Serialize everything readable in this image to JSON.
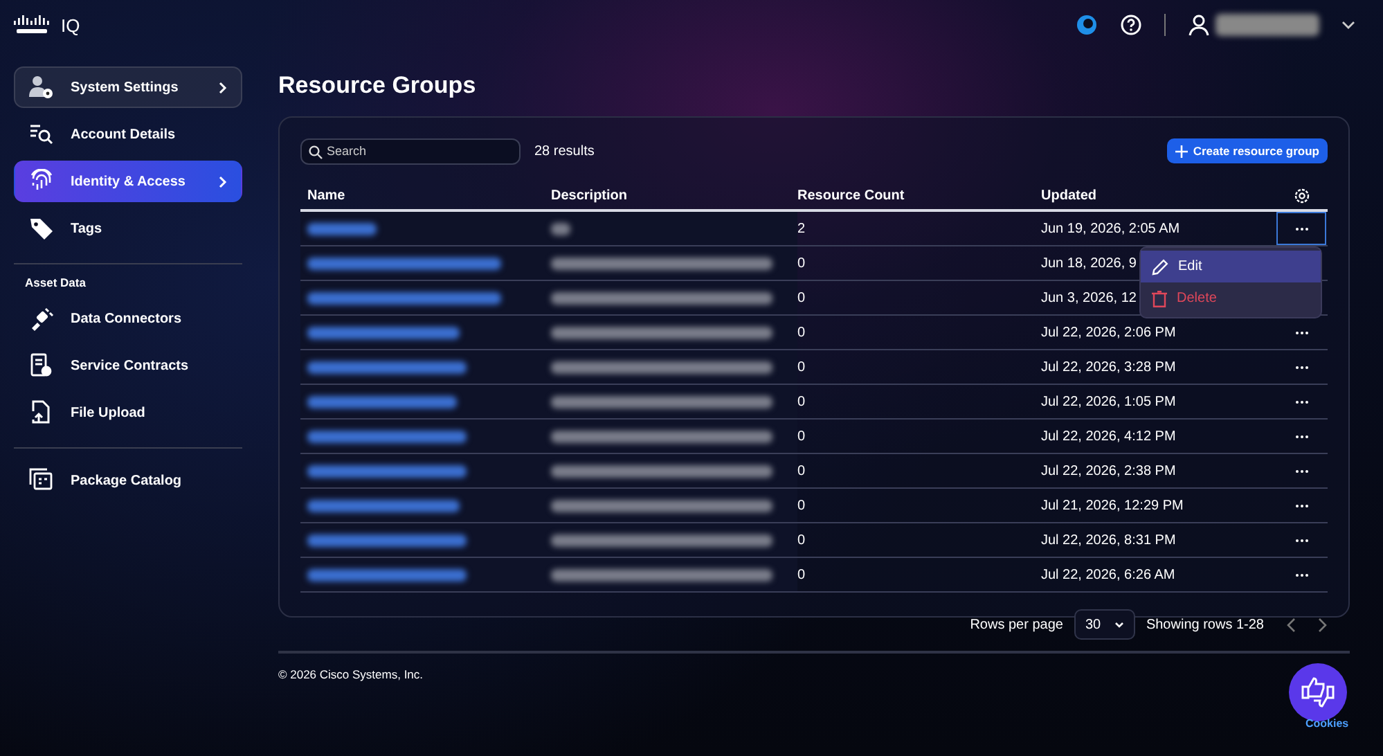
{
  "brand": {
    "product": "IQ"
  },
  "sidebar": {
    "items": [
      {
        "kind": "item",
        "label": "System Settings",
        "chevron": true,
        "selected": false,
        "boxed": true
      },
      {
        "kind": "item",
        "label": "Account Details",
        "chevron": false,
        "selected": false,
        "boxed": false
      },
      {
        "kind": "item",
        "label": "Identity & Access",
        "chevron": true,
        "selected": true,
        "boxed": false
      },
      {
        "kind": "item",
        "label": "Tags",
        "chevron": false,
        "selected": false,
        "boxed": false
      },
      {
        "kind": "divider"
      },
      {
        "kind": "heading",
        "label": "Asset Data"
      },
      {
        "kind": "item",
        "label": "Data Connectors",
        "chevron": false,
        "selected": false,
        "boxed": false
      },
      {
        "kind": "item",
        "label": "Service Contracts",
        "chevron": false,
        "selected": false,
        "boxed": false
      },
      {
        "kind": "item",
        "label": "File Upload",
        "chevron": false,
        "selected": false,
        "boxed": false
      },
      {
        "kind": "divider"
      },
      {
        "kind": "item",
        "label": "Package Catalog",
        "chevron": false,
        "selected": false,
        "boxed": false
      }
    ]
  },
  "page": {
    "title": "Resource Groups"
  },
  "toolbar": {
    "search": {
      "placeholder": "Search"
    },
    "results": "28 results",
    "create_button": "Create resource group"
  },
  "table": {
    "columns": [
      "Name",
      "Description",
      "Resource Count",
      "Updated"
    ],
    "rows": [
      {
        "count": "2",
        "updated": "Jun 19, 2026, 2:05 AM",
        "selected": true
      },
      {
        "count": "0",
        "updated": "Jun 18, 2026, 9"
      },
      {
        "count": "0",
        "updated": "Jun 3, 2026, 12"
      },
      {
        "count": "0",
        "updated": "Jul 22, 2026, 2:06 PM",
        "selected": false
      },
      {
        "count": "0",
        "updated": "Jul 22, 2026, 3:28 PM",
        "selected": false
      },
      {
        "count": "0",
        "updated": "Jul 22, 2026, 1:05 PM",
        "selected": false
      },
      {
        "count": "0",
        "updated": "Jul 22, 2026, 4:12 PM",
        "selected": false
      },
      {
        "count": "0",
        "updated": "Jul 22, 2026, 2:38 PM",
        "selected": false
      },
      {
        "count": "0",
        "updated": "Jul 21, 2026, 12:29 PM",
        "selected": false
      },
      {
        "count": "0",
        "updated": "Jul 22, 2026, 8:31 PM",
        "selected": false
      },
      {
        "count": "0",
        "updated": "Jul 22, 2026, 6:26 AM",
        "selected": false
      }
    ]
  },
  "row_menu": {
    "items": [
      {
        "label": "Edit",
        "kind": "edit",
        "selected": true
      },
      {
        "label": "Delete",
        "kind": "delete",
        "selected": false
      }
    ]
  },
  "pagination": {
    "rows_per_page_label": "Rows per page",
    "rows_per_page": "30",
    "range": "Showing rows 1-28"
  },
  "footer": {
    "copyright": "© 2026 Cisco Systems, Inc.",
    "cookies": "Cookies"
  }
}
